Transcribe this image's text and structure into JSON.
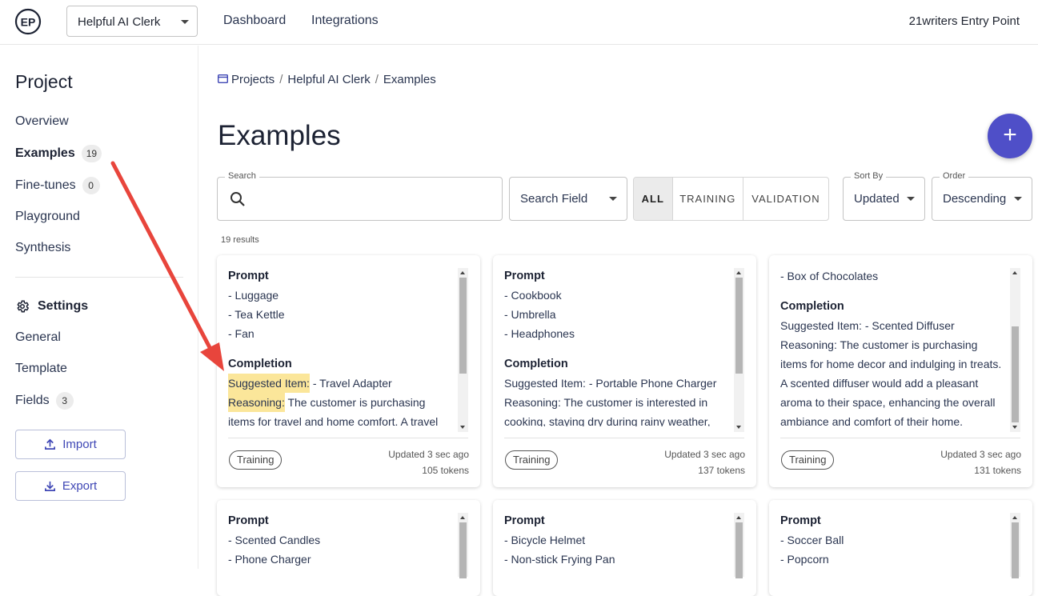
{
  "topbar": {
    "logo_text": "EP",
    "project_select": "Helpful AI Clerk",
    "nav": [
      "Dashboard",
      "Integrations"
    ],
    "org": "21writers Entry Point"
  },
  "sidebar": {
    "title": "Project",
    "items": [
      {
        "label": "Overview",
        "count": null,
        "active": false
      },
      {
        "label": "Examples",
        "count": "19",
        "active": true
      },
      {
        "label": "Fine-tunes",
        "count": "0",
        "active": false
      },
      {
        "label": "Playground",
        "count": null,
        "active": false
      },
      {
        "label": "Synthesis",
        "count": null,
        "active": false
      }
    ],
    "settings_label": "Settings",
    "settings_items": [
      {
        "label": "General",
        "count": null
      },
      {
        "label": "Template",
        "count": null
      },
      {
        "label": "Fields",
        "count": "3"
      }
    ],
    "import_label": "Import",
    "export_label": "Export"
  },
  "breadcrumb": [
    "Projects",
    "Helpful AI Clerk",
    "Examples"
  ],
  "page_title": "Examples",
  "fab_label": "+",
  "filters": {
    "search_label": "Search",
    "search_value": "",
    "search_field": "Search Field",
    "segments": [
      "ALL",
      "TRAINING",
      "VALIDATION"
    ],
    "active_segment": "ALL",
    "sort_label": "Sort By",
    "sort_value": "Updated",
    "order_label": "Order",
    "order_value": "Descending"
  },
  "results_text": "19 results",
  "cards": [
    {
      "lines": [
        {
          "t": "h",
          "text": "Prompt"
        },
        {
          "t": "p",
          "text": "- Luggage"
        },
        {
          "t": "p",
          "text": "- Tea Kettle"
        },
        {
          "t": "p",
          "text": "- Fan"
        },
        {
          "t": "gap"
        },
        {
          "t": "h",
          "text": "Completion"
        },
        {
          "t": "kv",
          "key": "Suggested Item:",
          "text": " - Travel Adapter",
          "hl": true
        },
        {
          "t": "kv",
          "key": "Reasoning:",
          "text": " The customer is purchasing",
          "hl": true
        },
        {
          "t": "p",
          "text": "items for travel and home comfort. A travel"
        }
      ],
      "tag": "Training",
      "updated": "Updated 3 sec ago",
      "tokens": "105 tokens",
      "scroll_pos": 0.0
    },
    {
      "lines": [
        {
          "t": "h",
          "text": "Prompt"
        },
        {
          "t": "p",
          "text": "- Cookbook"
        },
        {
          "t": "p",
          "text": "- Umbrella"
        },
        {
          "t": "p",
          "text": "- Headphones"
        },
        {
          "t": "gap"
        },
        {
          "t": "h",
          "text": "Completion"
        },
        {
          "t": "p",
          "text": "Suggested Item: - Portable Phone Charger"
        },
        {
          "t": "p",
          "text": "Reasoning: The customer is interested in"
        },
        {
          "t": "p",
          "text": "cooking, staying dry during rainy weather,"
        }
      ],
      "tag": "Training",
      "updated": "Updated 3 sec ago",
      "tokens": "137 tokens",
      "scroll_pos": 0.0
    },
    {
      "lines": [
        {
          "t": "p",
          "text": "- Box of Chocolates"
        },
        {
          "t": "gap"
        },
        {
          "t": "h",
          "text": "Completion"
        },
        {
          "t": "p",
          "text": "Suggested Item: - Scented Diffuser"
        },
        {
          "t": "p",
          "text": "Reasoning: The customer is purchasing"
        },
        {
          "t": "p",
          "text": "items for home decor and indulging in treats."
        },
        {
          "t": "p",
          "text": "A scented diffuser would add a pleasant"
        },
        {
          "t": "p",
          "text": "aroma to their space, enhancing the overall"
        },
        {
          "t": "p",
          "text": "ambiance and comfort of their home."
        }
      ],
      "tag": "Training",
      "updated": "Updated 3 sec ago",
      "tokens": "131 tokens",
      "scroll_pos": 1.0
    },
    {
      "lines": [
        {
          "t": "h",
          "text": "Prompt"
        },
        {
          "t": "p",
          "text": "- Scented Candles"
        },
        {
          "t": "p",
          "text": "- Phone Charger"
        }
      ],
      "scroll_pos": 0.0
    },
    {
      "lines": [
        {
          "t": "h",
          "text": "Prompt"
        },
        {
          "t": "p",
          "text": "- Bicycle Helmet"
        },
        {
          "t": "p",
          "text": "- Non-stick Frying Pan"
        }
      ],
      "scroll_pos": 0.0
    },
    {
      "lines": [
        {
          "t": "h",
          "text": "Prompt"
        },
        {
          "t": "p",
          "text": "- Soccer Ball"
        },
        {
          "t": "p",
          "text": "- Popcorn"
        }
      ],
      "scroll_pos": 0.0
    }
  ],
  "colors": {
    "accent": "#4f4fc8",
    "highlight": "#fbe69a",
    "annotation_arrow": "#e8453c"
  }
}
